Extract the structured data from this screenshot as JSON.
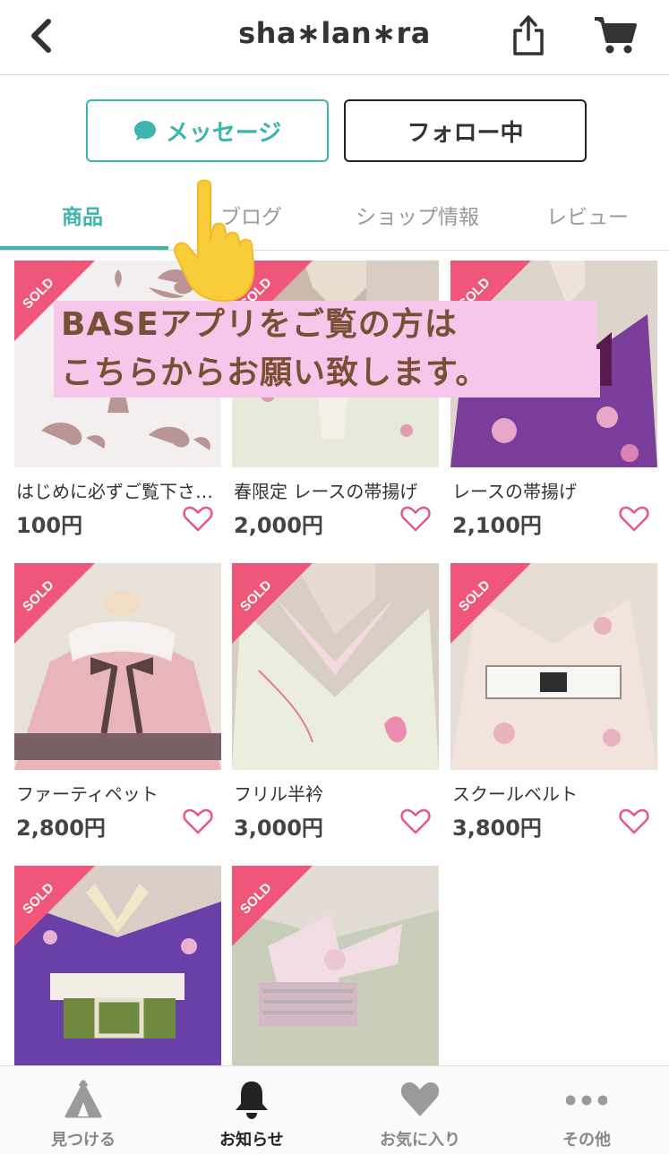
{
  "header": {
    "shop_name": "sha∗lan∗ra",
    "back_icon": "chevron-left-icon",
    "share_icon": "share-icon",
    "cart_icon": "cart-icon"
  },
  "actions": {
    "message_label": "メッセージ",
    "follow_label": "フォロー中"
  },
  "tabs": [
    {
      "label": "商品",
      "active": true
    },
    {
      "label": "ブログ",
      "active": false
    },
    {
      "label": "ショップ情報",
      "active": false
    },
    {
      "label": "レビュー",
      "active": false
    }
  ],
  "banner": {
    "line1": "BASEアプリをご覧の方は",
    "line2": "こちらからお願い致します。"
  },
  "products": [
    {
      "name": "はじめに必ずご覧下さ…",
      "price": "100円",
      "sold": true
    },
    {
      "name": "春限定 レースの帯揚げ",
      "price": "2,000円",
      "sold": true
    },
    {
      "name": "レースの帯揚げ",
      "price": "2,100円",
      "sold": true
    },
    {
      "name": "ファーティペット",
      "price": "2,800円",
      "sold": true
    },
    {
      "name": "フリル半衿",
      "price": "3,000円",
      "sold": true
    },
    {
      "name": "スクールベルト",
      "price": "3,800円",
      "sold": true
    },
    {
      "name": "",
      "price": "",
      "sold": true
    },
    {
      "name": "",
      "price": "",
      "sold": true
    }
  ],
  "sold_label": "SOLD",
  "watermark": "sha∗lan∗ra",
  "bottom_nav": [
    {
      "label": "見つける",
      "icon": "tent-icon",
      "active": false
    },
    {
      "label": "お知らせ",
      "icon": "bell-icon",
      "active": true
    },
    {
      "label": "お気に入り",
      "icon": "heart-icon",
      "active": false
    },
    {
      "label": "その他",
      "icon": "more-dots-icon",
      "active": false
    }
  ],
  "colors": {
    "accent": "#3bb5ae",
    "sold_ribbon": "#f0567a",
    "heart": "#e8577f",
    "banner_bg": "#f6c7ea",
    "banner_text": "#7b4f35"
  }
}
